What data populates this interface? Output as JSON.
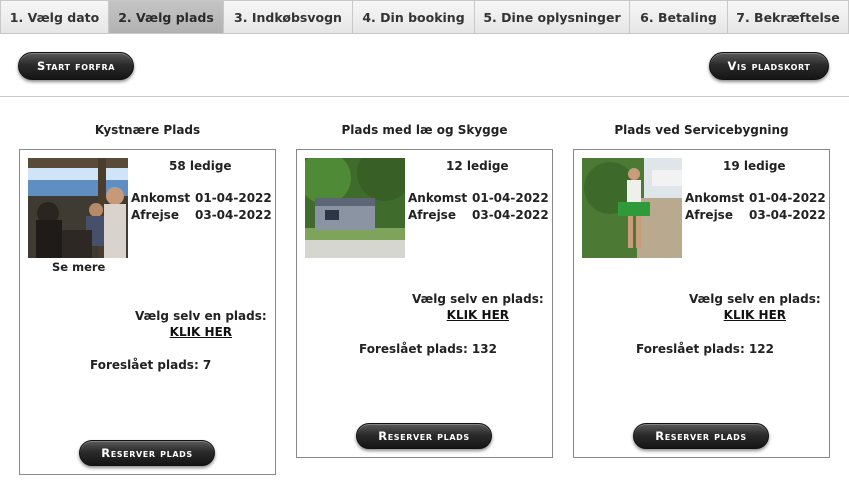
{
  "tabs": [
    {
      "label": "1. Vælg dato"
    },
    {
      "label": "2. Vælg plads"
    },
    {
      "label": "3. Indkøbsvogn"
    },
    {
      "label": "4. Din booking"
    },
    {
      "label": "5. Dine oplysninger"
    },
    {
      "label": "6. Betaling"
    },
    {
      "label": "7. Bekræftelse"
    }
  ],
  "actions": {
    "start_over": "Start forfra",
    "show_map": "Vis pladskort"
  },
  "labels": {
    "arrival": "Ankomst",
    "departure": "Afrejse",
    "see_more": "Se mere",
    "choose_self": "Vælg selv en plads:",
    "click_here": "KLIK HER",
    "reserve": "Reserver plads"
  },
  "places": [
    {
      "title": "Kystnære Plads",
      "available": "58 ledige",
      "arrival": "01-04-2022",
      "departure": "03-04-2022",
      "suggested": "Foreslået plads: 7",
      "image": "people-at-sea-view-photo"
    },
    {
      "title": "Plads med læ og Skygge",
      "available": "12 ledige",
      "arrival": "01-04-2022",
      "departure": "03-04-2022",
      "suggested": "Foreslået plads: 132",
      "image": "caravan-under-trees-photo"
    },
    {
      "title": "Plads ved Servicebygning",
      "available": "19 ledige",
      "arrival": "01-04-2022",
      "departure": "03-04-2022",
      "suggested": "Foreslået plads: 122",
      "image": "girl-with-crate-photo"
    }
  ]
}
